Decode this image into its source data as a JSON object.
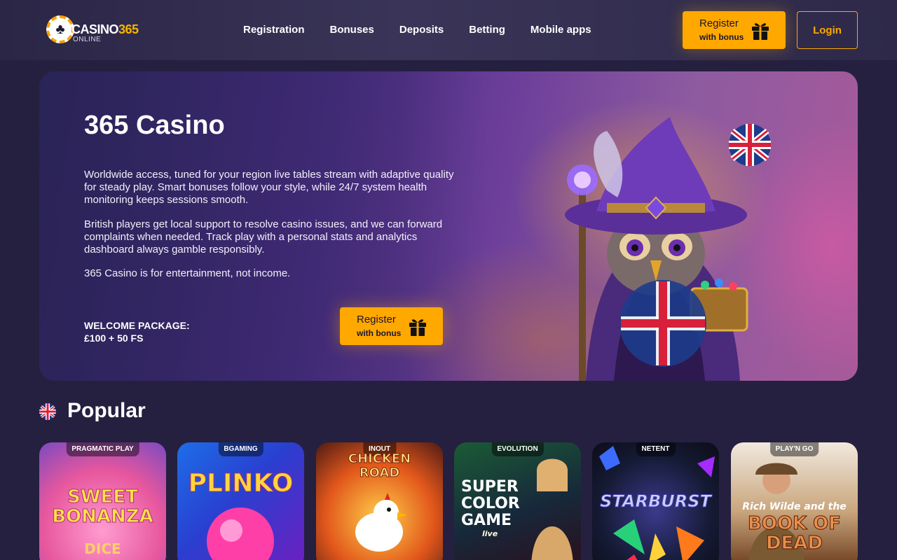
{
  "header": {
    "logo_main": "CASINO",
    "logo_num": "365",
    "logo_sub": "ONLINE",
    "nav": [
      "Registration",
      "Bonuses",
      "Deposits",
      "Betting",
      "Mobile apps"
    ],
    "register_l1": "Register",
    "register_l2": "with bonus",
    "login": "Login"
  },
  "hero": {
    "title": "365 Casino",
    "p1": "Worldwide access, tuned for your region live tables stream with adaptive quality for steady play. Smart bonuses follow your style, while 24/7 system health monitoring keeps sessions smooth.",
    "p2": "British players get local support to resolve casino issues, and we can forward complaints when needed. Track play with a personal stats and analytics dashboard always gamble responsibly.",
    "p3": "365 Casino is for entertainment, not income.",
    "welcome_l1": "WELCOME PACKAGE:",
    "welcome_l2": "£100 + 50 FS",
    "register_l1": "Register",
    "register_l2": "with bonus"
  },
  "popular": {
    "title": "Popular",
    "games": [
      {
        "provider": "PRAGMATIC PLAY",
        "title": "SWEET BONANZA",
        "sub": "DICE"
      },
      {
        "provider": "BGAMING",
        "title": "PLINKO",
        "sub": ""
      },
      {
        "provider": "INOUT",
        "title": "CHICKEN ROAD",
        "sub": ""
      },
      {
        "provider": "EVOLUTION",
        "title": "SUPER COLOR GAME",
        "sub": "live"
      },
      {
        "provider": "NETENT",
        "title": "STARBURST",
        "sub": ""
      },
      {
        "provider": "PLAY'N GO",
        "title": "Rich Wilde and the",
        "sub": "BOOK OF DEAD"
      }
    ]
  },
  "colors": {
    "accent": "#ffa800",
    "bg": "#25203f"
  }
}
